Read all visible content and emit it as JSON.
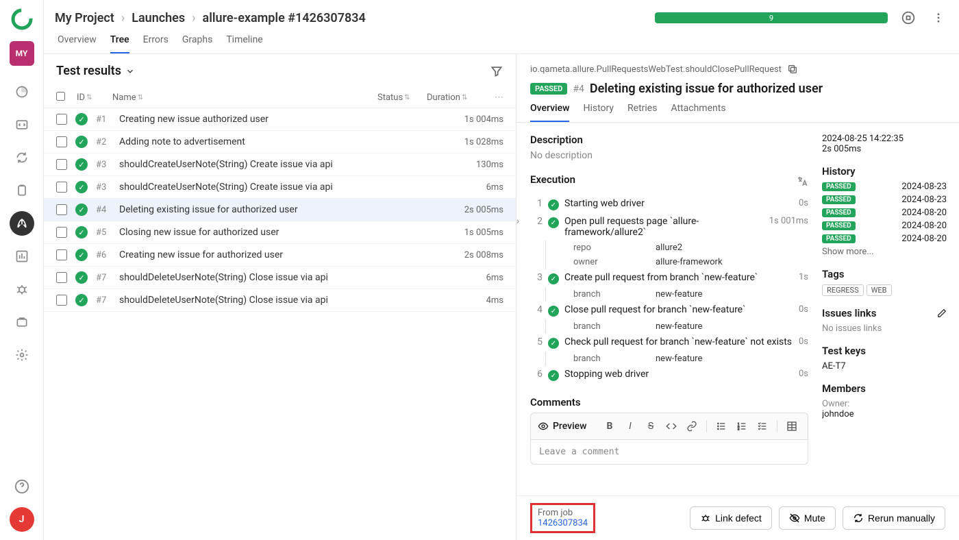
{
  "breadcrumb": {
    "project": "My Project",
    "section": "Launches",
    "launch": "allure-example #1426307834"
  },
  "progress": {
    "count": "9"
  },
  "tabs": {
    "overview": "Overview",
    "tree": "Tree",
    "errors": "Errors",
    "graphs": "Graphs",
    "timeline": "Timeline"
  },
  "left": {
    "title": "Test results",
    "columns": {
      "id": "ID",
      "name": "Name",
      "status": "Status",
      "duration": "Duration"
    },
    "rows": [
      {
        "num": "#1",
        "name": "Creating new issue authorized user",
        "duration": "1s 004ms"
      },
      {
        "num": "#2",
        "name": "Adding note to advertisement",
        "duration": "1s 028ms"
      },
      {
        "num": "#3",
        "name": "shouldCreateUserNote(String) Create issue via api",
        "duration": "130ms"
      },
      {
        "num": "#3",
        "name": "shouldCreateUserNote(String) Create issue via api",
        "duration": "6ms"
      },
      {
        "num": "#4",
        "name": "Deleting existing issue for authorized user",
        "duration": "2s 005ms"
      },
      {
        "num": "#5",
        "name": "Closing new issue for authorized user",
        "duration": "1s 005ms"
      },
      {
        "num": "#6",
        "name": "Creating new issue for authorized user",
        "duration": "2s 008ms"
      },
      {
        "num": "#7",
        "name": "shouldDeleteUserNote(String) Close issue via api",
        "duration": "6ms"
      },
      {
        "num": "#7",
        "name": "shouldDeleteUserNote(String) Close issue via api",
        "duration": "4ms"
      }
    ]
  },
  "detail": {
    "path": "io.qameta.allure.PullRequestsWebTest.shouldClosePullRequest",
    "status": "PASSED",
    "num": "#4",
    "title": "Deleting existing issue for authorized user",
    "tabs": {
      "overview": "Overview",
      "history": "History",
      "retries": "Retries",
      "attachments": "Attachments"
    },
    "description_label": "Description",
    "no_description": "No description",
    "execution_label": "Execution",
    "steps": [
      {
        "n": "1",
        "text": "Starting web driver",
        "dur": "0s",
        "params": []
      },
      {
        "n": "2",
        "text": "Open pull requests page `allure-framework/allure2`",
        "dur": "1s 001ms",
        "expand": true,
        "params": [
          {
            "k": "repo",
            "v": "allure2"
          },
          {
            "k": "owner",
            "v": "allure-framework"
          }
        ]
      },
      {
        "n": "3",
        "text": "Create pull request from branch `new-feature`",
        "dur": "1s",
        "params": [
          {
            "k": "branch",
            "v": "new-feature"
          }
        ]
      },
      {
        "n": "4",
        "text": "Close pull request for branch `new-feature`",
        "dur": "0s",
        "params": [
          {
            "k": "branch",
            "v": "new-feature"
          }
        ]
      },
      {
        "n": "5",
        "text": "Check pull request for branch `new-feature` not exists",
        "dur": "0s",
        "params": [
          {
            "k": "branch",
            "v": "new-feature"
          }
        ]
      },
      {
        "n": "6",
        "text": "Stopping web driver",
        "dur": "0s",
        "params": []
      }
    ],
    "comments_label": "Comments",
    "preview_label": "Preview",
    "comment_placeholder": "Leave a comment"
  },
  "side": {
    "timestamp": "2024-08-25 14:22:35",
    "duration": "2s 005ms",
    "history_label": "History",
    "history": [
      {
        "status": "PASSED",
        "date": "2024-08-23"
      },
      {
        "status": "PASSED",
        "date": "2024-08-23"
      },
      {
        "status": "PASSED",
        "date": "2024-08-20"
      },
      {
        "status": "PASSED",
        "date": "2024-08-20"
      },
      {
        "status": "PASSED",
        "date": "2024-08-20"
      }
    ],
    "show_more": "Show more...",
    "tags_label": "Tags",
    "tags": [
      "REGRESS",
      "WEB"
    ],
    "issues_label": "Issues links",
    "no_issues": "No issues links",
    "testkeys_label": "Test keys",
    "testkeys": "AE-T7",
    "members_label": "Members",
    "owner_label": "Owner:",
    "owner": "johndoe"
  },
  "footer": {
    "from_job": "From job",
    "job_id": "1426307834",
    "link_defect": "Link defect",
    "mute": "Mute",
    "rerun": "Rerun manually"
  },
  "sidebar": {
    "project": "MY",
    "user": "J"
  }
}
